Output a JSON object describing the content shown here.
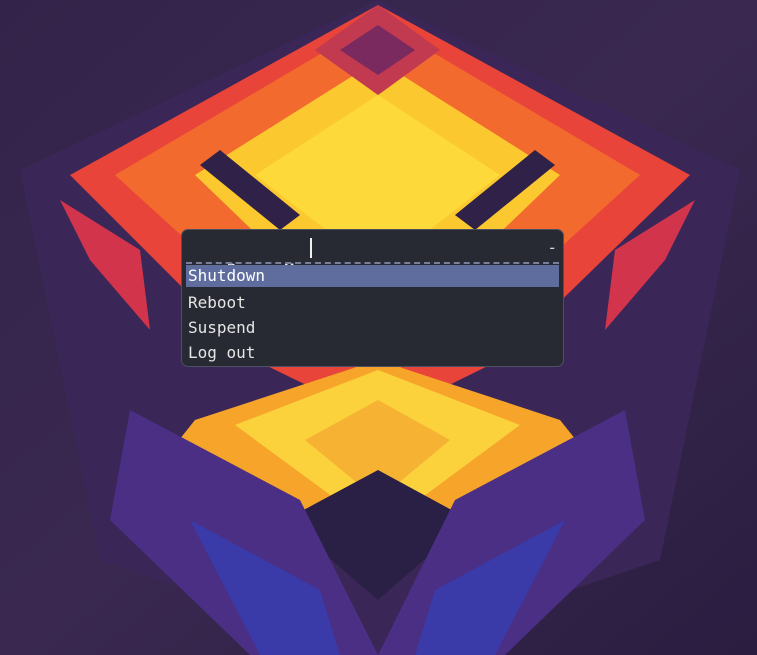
{
  "prompt": {
    "label": "Power Menu:",
    "input_value": "",
    "count_indicator": "-"
  },
  "entries": [
    {
      "label": "Shutdown",
      "selected": true
    },
    {
      "label": "Reboot",
      "selected": false
    },
    {
      "label": "Suspend",
      "selected": false
    },
    {
      "label": "Log out",
      "selected": false
    }
  ],
  "colors": {
    "menu_background": "#282a33",
    "menu_border": "#4c5063",
    "selection": "#5f6d9e",
    "text": "#e6e6e6",
    "wallpaper_base": "#2b1f45"
  }
}
